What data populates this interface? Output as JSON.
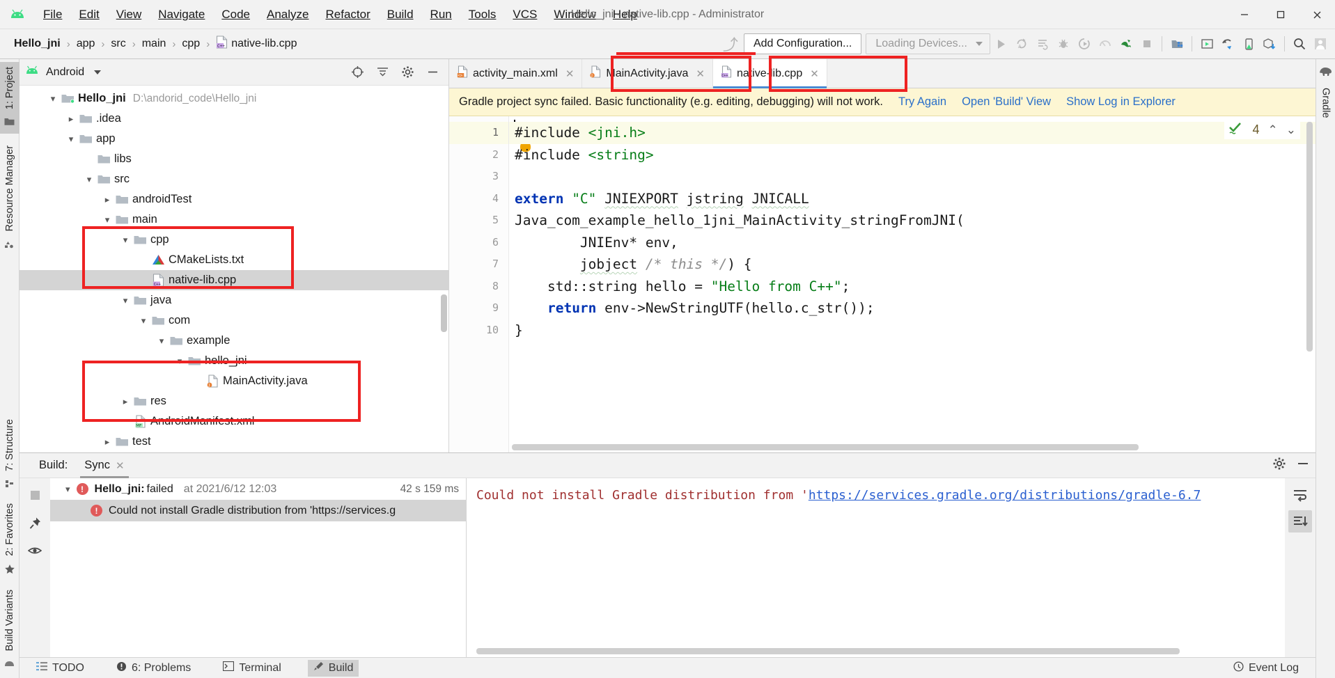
{
  "window": {
    "title": "Hello_jni - native-lib.cpp - Administrator",
    "minimize": "─",
    "maximize": "☐",
    "close": "✕"
  },
  "menu": [
    {
      "label": "File"
    },
    {
      "label": "Edit"
    },
    {
      "label": "View"
    },
    {
      "label": "Navigate"
    },
    {
      "label": "Code"
    },
    {
      "label": "Analyze"
    },
    {
      "label": "Refactor"
    },
    {
      "label": "Build"
    },
    {
      "label": "Run"
    },
    {
      "label": "Tools"
    },
    {
      "label": "VCS"
    },
    {
      "label": "Window"
    },
    {
      "label": "Help"
    }
  ],
  "breadcrumb": {
    "items": [
      "Hello_jni",
      "app",
      "src",
      "main",
      "cpp",
      "native-lib.cpp"
    ],
    "separator": "›"
  },
  "toolbar": {
    "add_configuration": "Add Configuration...",
    "loading_devices": "Loading Devices...",
    "icons": [
      "run-icon",
      "rerun-icon",
      "apply-changes-icon",
      "debug-icon",
      "attach-debugger-icon",
      "profiler-icon",
      "lizard-icon",
      "stop-icon",
      "sdk-manager-icon",
      "avd-manager-icon",
      "sync-gradle-icon",
      "device-file-explorer-icon",
      "sdk-download-icon",
      "search-icon",
      "profile-icon"
    ]
  },
  "left_rail": {
    "top": [
      "1: Project",
      "Resource Manager"
    ],
    "bottom": [
      "7: Structure",
      "2: Favorites",
      "Build Variants"
    ]
  },
  "right_rail": {
    "items": [
      "Gradle"
    ]
  },
  "project_panel": {
    "header": {
      "title": "Android",
      "icons": [
        "target-icon",
        "collapse-all-icon",
        "settings-icon",
        "hide-icon"
      ]
    },
    "tree": [
      {
        "depth": 0,
        "chevron": "v",
        "icon": "folder-module-icon",
        "label": "Hello_jni",
        "bold": true,
        "path": "D:\\andorid_code\\Hello_jni"
      },
      {
        "depth": 1,
        "chevron": ">",
        "icon": "folder-icon",
        "label": ".idea",
        "bold": false,
        "path": ""
      },
      {
        "depth": 1,
        "chevron": "v",
        "icon": "folder-icon",
        "label": "app",
        "bold": false,
        "path": ""
      },
      {
        "depth": 2,
        "chevron": "",
        "icon": "folder-icon",
        "label": "libs",
        "bold": false,
        "path": ""
      },
      {
        "depth": 2,
        "chevron": "v",
        "icon": "folder-icon",
        "label": "src",
        "bold": false,
        "path": ""
      },
      {
        "depth": 3,
        "chevron": ">",
        "icon": "folder-icon",
        "label": "androidTest",
        "bold": false,
        "path": ""
      },
      {
        "depth": 3,
        "chevron": "v",
        "icon": "folder-icon",
        "label": "main",
        "bold": false,
        "path": ""
      },
      {
        "depth": 4,
        "chevron": "v",
        "icon": "folder-icon",
        "label": "cpp",
        "bold": false,
        "path": ""
      },
      {
        "depth": 5,
        "chevron": "",
        "icon": "cmake-icon",
        "label": "CMakeLists.txt",
        "bold": false,
        "path": ""
      },
      {
        "depth": 5,
        "chevron": "",
        "icon": "cpp-file-icon",
        "label": "native-lib.cpp",
        "bold": false,
        "path": "",
        "selected": true
      },
      {
        "depth": 4,
        "chevron": "v",
        "icon": "folder-icon",
        "label": "java",
        "bold": false,
        "path": ""
      },
      {
        "depth": 5,
        "chevron": "v",
        "icon": "folder-icon",
        "label": "com",
        "bold": false,
        "path": ""
      },
      {
        "depth": 6,
        "chevron": "v",
        "icon": "folder-icon",
        "label": "example",
        "bold": false,
        "path": ""
      },
      {
        "depth": 7,
        "chevron": "v",
        "icon": "folder-icon",
        "label": "hello_jni",
        "bold": false,
        "path": ""
      },
      {
        "depth": 8,
        "chevron": "",
        "icon": "java-file-icon",
        "label": "MainActivity.java",
        "bold": false,
        "path": ""
      },
      {
        "depth": 4,
        "chevron": ">",
        "icon": "folder-icon",
        "label": "res",
        "bold": false,
        "path": ""
      },
      {
        "depth": 4,
        "chevron": "",
        "icon": "manifest-icon",
        "label": "AndroidManifest.xml",
        "bold": false,
        "path": ""
      },
      {
        "depth": 3,
        "chevron": ">",
        "icon": "folder-icon",
        "label": "test",
        "bold": false,
        "path": ""
      }
    ]
  },
  "editor": {
    "tabs": [
      {
        "label": "activity_main.xml",
        "icon": "xml-file-icon",
        "active": false,
        "close": "✕"
      },
      {
        "label": "MainActivity.java",
        "icon": "java-file-icon",
        "active": false,
        "close": "✕"
      },
      {
        "label": "native-lib.cpp",
        "icon": "cpp-file-icon",
        "active": true,
        "close": "✕"
      }
    ],
    "notification": {
      "message": "Gradle project sync failed. Basic functionality (e.g. editing, debugging) will not work.",
      "links": [
        "Try Again",
        "Open 'Build' View",
        "Show Log in Explorer"
      ]
    },
    "inspection": {
      "status_icon": "inspection-ok-icon",
      "count": "4",
      "prev": "⌃",
      "next": "⌄"
    },
    "line_numbers": [
      "1",
      "2",
      "3",
      "4",
      "5",
      "6",
      "7",
      "8",
      "9",
      "10"
    ],
    "lines": [
      "#include <jni.h>",
      "#include <string>",
      "",
      "extern \"C\" JNIEXPORT jstring JNICALL",
      "Java_com_example_hello_1jni_MainActivity_stringFromJNI(",
      "        JNIEnv* env,",
      "        jobject /* this */) {",
      "    std::string hello = \"Hello from C++\";",
      "    return env->NewStringUTF(hello.c_str());",
      "}"
    ]
  },
  "build_panel": {
    "label": "Build:",
    "tab": {
      "label": "Sync",
      "close": "✕"
    },
    "header_icons": [
      "settings-icon",
      "minimize-icon"
    ],
    "left_icons": [
      "stop-icon",
      "pin-icon",
      "eye-icon"
    ],
    "tree": [
      {
        "chevron": "v",
        "bold_label": "Hello_jni:",
        "label": " failed",
        "time_text": "at 2021/6/12 12:03",
        "duration": "42 s 159 ms",
        "selected": false
      },
      {
        "chevron": "",
        "bold_label": "",
        "label": "Could not install Gradle distribution from 'https://services.g",
        "time_text": "",
        "duration": "",
        "selected": true
      }
    ],
    "detail": {
      "prefix": "Could not install Gradle distribution from '",
      "link": "https://services.gradle.org/distributions/gradle-6.7"
    },
    "right_icons": [
      "soft-wrap-icon",
      "scroll-to-end-icon"
    ]
  },
  "status_bar": {
    "items": [
      {
        "label": "TODO",
        "icon": "todo-icon",
        "selected": false
      },
      {
        "label": "6: Problems",
        "icon": "problems-icon",
        "selected": false
      },
      {
        "label": "Terminal",
        "icon": "terminal-icon",
        "selected": false
      },
      {
        "label": "Build",
        "icon": "build-icon",
        "selected": true
      }
    ],
    "right": [
      {
        "label": "Event Log",
        "icon": "event-log-icon"
      }
    ]
  },
  "colors": {
    "accent": "#2a6fc9",
    "annotation": "#ee2222",
    "notify_bg": "#fdf6d3",
    "error": "#e05a5a"
  }
}
